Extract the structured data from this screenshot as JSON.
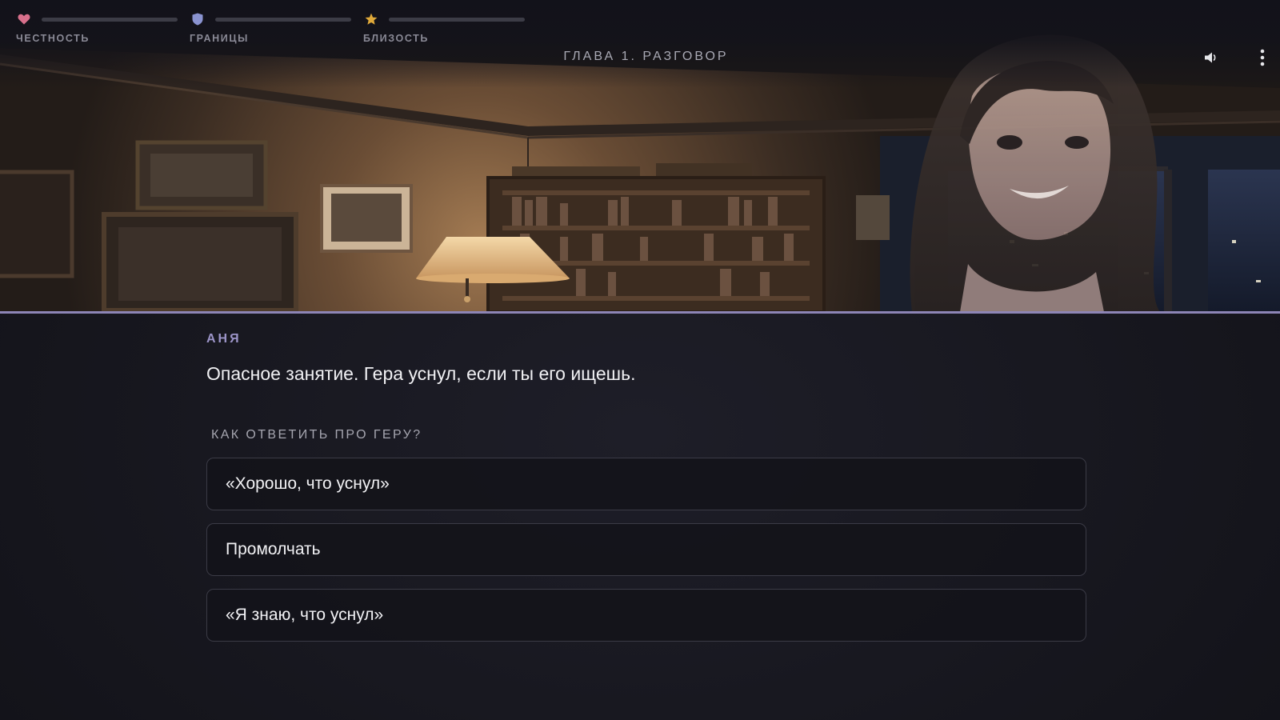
{
  "stats": [
    {
      "label": "ЧЕСТНОСТЬ",
      "icon": "heart-icon",
      "color": "#d8708c",
      "level": 0.0
    },
    {
      "label": "ГРАНИЦЫ",
      "icon": "shield-icon",
      "color": "#8a93d0",
      "level": 0.0
    },
    {
      "label": "БЛИЗОСТЬ",
      "icon": "star-icon",
      "color": "#e0a93a",
      "level": 0.0
    }
  ],
  "chapter_title": "ГЛАВА 1. РАЗГОВОР",
  "controls": {
    "sound_icon": "speaker-icon",
    "menu_icon": "more-vertical-icon"
  },
  "dialog": {
    "speaker": "АНЯ",
    "line": "Опасное занятие. Гера уснул, если ты его ищешь.",
    "prompt": "КАК ОТВЕТИТЬ ПРО ГЕРУ?",
    "choices": [
      "«Хорошо, что уснул»",
      "Промолчать",
      "«Я знаю, что уснул»"
    ]
  },
  "colors": {
    "accent": "#9c94c8",
    "background": "#16161e",
    "divider": "#8d85b6"
  }
}
